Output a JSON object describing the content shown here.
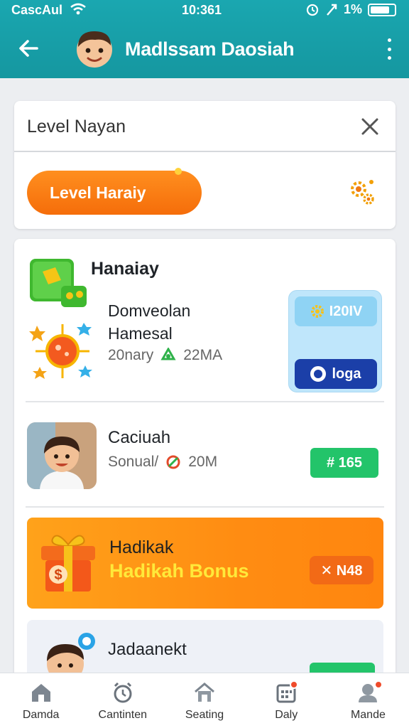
{
  "status_bar": {
    "carrier": "CascAul",
    "time": "10:361",
    "battery_text": "1%"
  },
  "header": {
    "title": "Madlssam Daosiah"
  },
  "search": {
    "placeholder": "Level Nayan"
  },
  "level_button": {
    "label": "Level Haraiy"
  },
  "items": [
    {
      "title": "Hanaiay",
      "line1": "Domveolan",
      "line2": "Hamesal",
      "meta_left": "20nary",
      "meta_right": "22MA",
      "primary_action": "I20IV",
      "secondary_action": "loga"
    },
    {
      "title": "Caciuah",
      "meta_left": "Sonual/",
      "meta_right": "20M",
      "action": "# 165"
    },
    {
      "title": "Hadikak",
      "subtitle": "Hadikah Bonus",
      "action": "✕ N48"
    },
    {
      "title": "Jadaanekt"
    }
  ],
  "tabs": [
    {
      "label": "Damda",
      "icon": "home-icon"
    },
    {
      "label": "Cantinten",
      "icon": "alarm-clock-icon"
    },
    {
      "label": "Seating",
      "icon": "home-icon"
    },
    {
      "label": "Daly",
      "icon": "calendar-icon",
      "badge": true
    },
    {
      "label": "Mande",
      "icon": "profile-icon",
      "badge": true
    }
  ],
  "colors": {
    "header": "#1aa7b0",
    "accent_orange": "#f56d0a",
    "green": "#23c46a",
    "blue": "#1b3fa8"
  }
}
